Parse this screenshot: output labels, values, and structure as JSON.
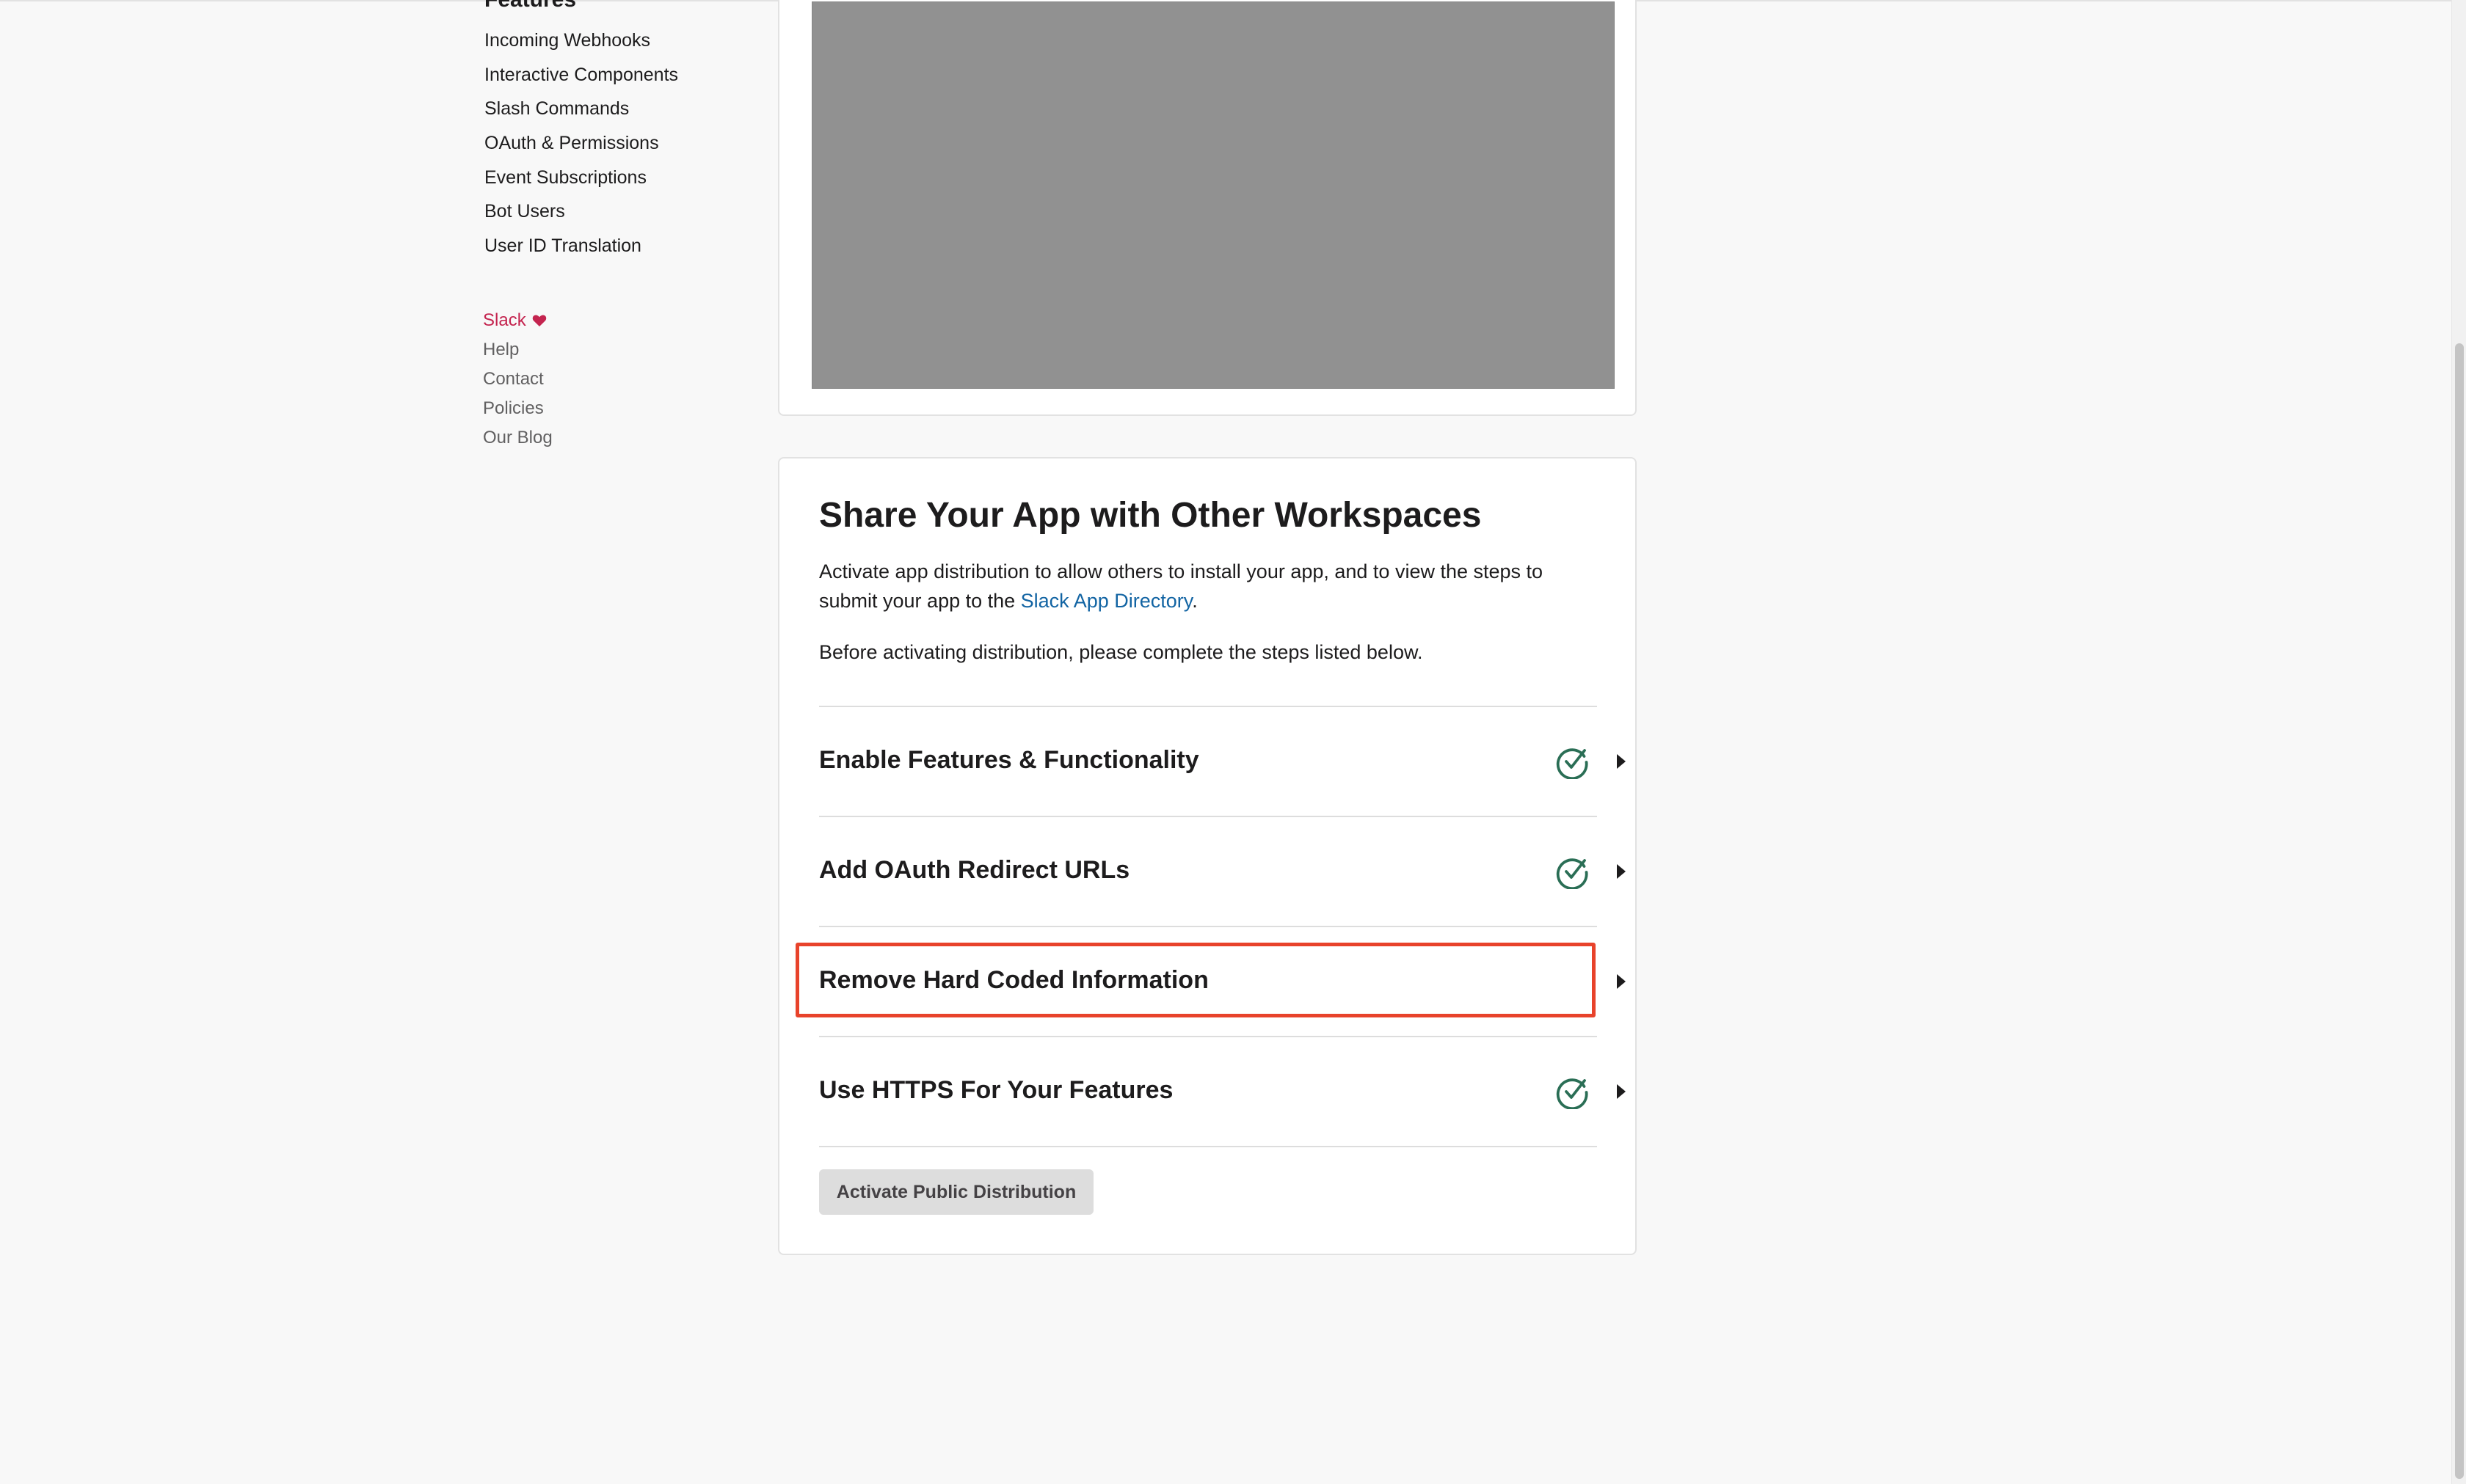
{
  "sidebar": {
    "section_heading": "Features",
    "nav_items": [
      {
        "label": "Incoming Webhooks"
      },
      {
        "label": "Interactive Components"
      },
      {
        "label": "Slash Commands"
      },
      {
        "label": "OAuth & Permissions"
      },
      {
        "label": "Event Subscriptions"
      },
      {
        "label": "Bot Users"
      },
      {
        "label": "User ID Translation"
      }
    ],
    "footer_links": [
      {
        "label": "Slack",
        "icon": "heart-icon"
      },
      {
        "label": "Help"
      },
      {
        "label": "Contact"
      },
      {
        "label": "Policies"
      },
      {
        "label": "Our Blog"
      }
    ]
  },
  "share": {
    "title": "Share Your App with Other Workspaces",
    "description_before": "Activate app distribution to allow others to install your app, and to view the steps to submit your app to the ",
    "directory_link": "Slack App Directory",
    "description_after": ".",
    "note": "Before activating distribution, please complete the steps listed below.",
    "steps": [
      {
        "label": "Enable Features & Functionality",
        "completed": true,
        "highlighted": false
      },
      {
        "label": "Add OAuth Redirect URLs",
        "completed": true,
        "highlighted": false
      },
      {
        "label": "Remove Hard Coded Information",
        "completed": false,
        "highlighted": true
      },
      {
        "label": "Use HTTPS For Your Features",
        "completed": true,
        "highlighted": false
      }
    ],
    "activate_button": "Activate Public Distribution"
  },
  "colors": {
    "brand_red": "#c4244f",
    "link_blue": "#1264a3",
    "check_green": "#2a6e55",
    "highlight_red": "#e8432b"
  }
}
